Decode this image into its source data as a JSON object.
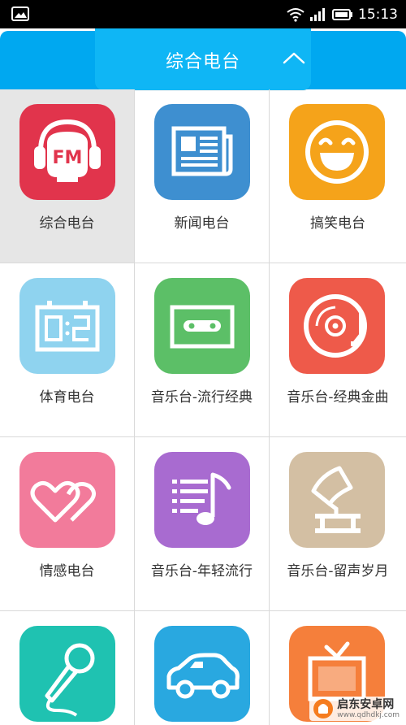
{
  "status_bar": {
    "time": "15:13"
  },
  "header": {
    "title": "综合电台"
  },
  "colors": {
    "accent": "#00a8f0",
    "selected": "#e6e6e6"
  },
  "grid": {
    "items": [
      {
        "label": "综合电台",
        "icon": "fm-headphones-icon",
        "color": "#e1344c",
        "selected": true
      },
      {
        "label": "新闻电台",
        "icon": "newspaper-icon",
        "color": "#3e8fd0"
      },
      {
        "label": "搞笑电台",
        "icon": "laugh-face-icon",
        "color": "#f5a31a"
      },
      {
        "label": "体育电台",
        "icon": "scoreboard-icon",
        "color": "#8fd3ef"
      },
      {
        "label": "音乐台-流行经典",
        "icon": "cassette-icon",
        "color": "#5cbf67"
      },
      {
        "label": "音乐台-经典金曲",
        "icon": "record-player-icon",
        "color": "#ee5a4a"
      },
      {
        "label": "情感电台",
        "icon": "hearts-icon",
        "color": "#f27b9b"
      },
      {
        "label": "音乐台-年轻流行",
        "icon": "music-note-icon",
        "color": "#a86bd0"
      },
      {
        "label": "音乐台-留声岁月",
        "icon": "gramophone-icon",
        "color": "#d3bfa3"
      },
      {
        "label": "",
        "icon": "microphone-icon",
        "color": "#1fc2b1"
      },
      {
        "label": "",
        "icon": "car-icon",
        "color": "#29a8e0"
      },
      {
        "label": "",
        "icon": "tv-icon",
        "color": "#f57f3b"
      }
    ]
  },
  "watermark": {
    "name": "启东安卓网",
    "url": "www.qdhdkj.com"
  }
}
